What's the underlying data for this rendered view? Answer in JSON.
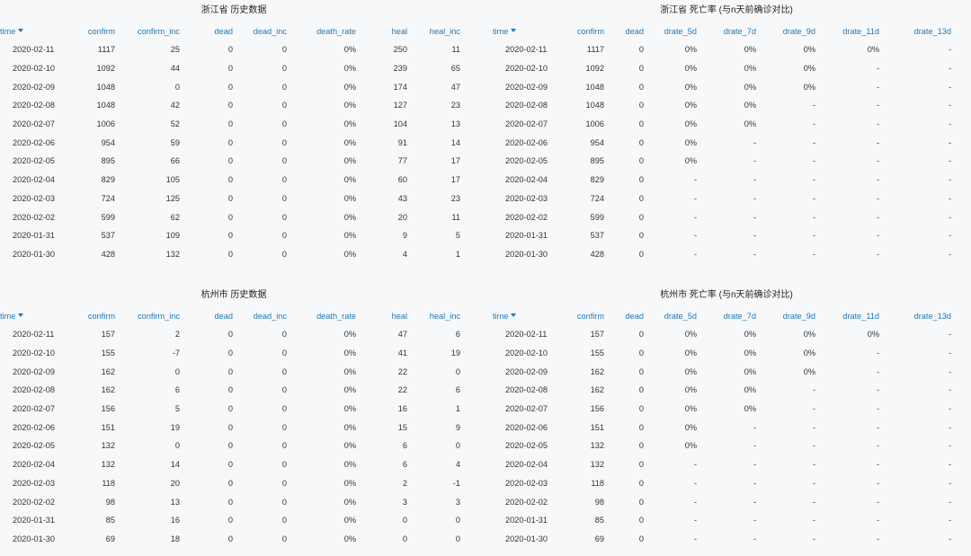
{
  "panels": [
    {
      "title": "浙江省 历史数据",
      "columns": [
        "time",
        "confirm",
        "confirm_inc",
        "dead",
        "dead_inc",
        "death_rate",
        "heal",
        "heal_inc"
      ],
      "rows": [
        [
          "2020-02-11",
          "1117",
          "25",
          "0",
          "0",
          "0%",
          "250",
          "11"
        ],
        [
          "2020-02-10",
          "1092",
          "44",
          "0",
          "0",
          "0%",
          "239",
          "65"
        ],
        [
          "2020-02-09",
          "1048",
          "0",
          "0",
          "0",
          "0%",
          "174",
          "47"
        ],
        [
          "2020-02-08",
          "1048",
          "42",
          "0",
          "0",
          "0%",
          "127",
          "23"
        ],
        [
          "2020-02-07",
          "1006",
          "52",
          "0",
          "0",
          "0%",
          "104",
          "13"
        ],
        [
          "2020-02-06",
          "954",
          "59",
          "0",
          "0",
          "0%",
          "91",
          "14"
        ],
        [
          "2020-02-05",
          "895",
          "66",
          "0",
          "0",
          "0%",
          "77",
          "17"
        ],
        [
          "2020-02-04",
          "829",
          "105",
          "0",
          "0",
          "0%",
          "60",
          "17"
        ],
        [
          "2020-02-03",
          "724",
          "125",
          "0",
          "0",
          "0%",
          "43",
          "23"
        ],
        [
          "2020-02-02",
          "599",
          "62",
          "0",
          "0",
          "0%",
          "20",
          "11"
        ],
        [
          "2020-01-31",
          "537",
          "109",
          "0",
          "0",
          "0%",
          "9",
          "5"
        ],
        [
          "2020-01-30",
          "428",
          "132",
          "0",
          "0",
          "0%",
          "4",
          "1"
        ]
      ]
    },
    {
      "title": "浙江省 死亡率 (与n天前确诊对比)",
      "columns": [
        "time",
        "confirm",
        "dead",
        "drate_5d",
        "drate_7d",
        "drate_9d",
        "drate_11d",
        "drate_13d"
      ],
      "rows": [
        [
          "2020-02-11",
          "1117",
          "0",
          "0%",
          "0%",
          "0%",
          "0%",
          "-"
        ],
        [
          "2020-02-10",
          "1092",
          "0",
          "0%",
          "0%",
          "0%",
          "-",
          "-"
        ],
        [
          "2020-02-09",
          "1048",
          "0",
          "0%",
          "0%",
          "0%",
          "-",
          "-"
        ],
        [
          "2020-02-08",
          "1048",
          "0",
          "0%",
          "0%",
          "-",
          "-",
          "-"
        ],
        [
          "2020-02-07",
          "1006",
          "0",
          "0%",
          "0%",
          "-",
          "-",
          "-"
        ],
        [
          "2020-02-06",
          "954",
          "0",
          "0%",
          "-",
          "-",
          "-",
          "-"
        ],
        [
          "2020-02-05",
          "895",
          "0",
          "0%",
          "-",
          "-",
          "-",
          "-"
        ],
        [
          "2020-02-04",
          "829",
          "0",
          "-",
          "-",
          "-",
          "-",
          "-"
        ],
        [
          "2020-02-03",
          "724",
          "0",
          "-",
          "-",
          "-",
          "-",
          "-"
        ],
        [
          "2020-02-02",
          "599",
          "0",
          "-",
          "-",
          "-",
          "-",
          "-"
        ],
        [
          "2020-01-31",
          "537",
          "0",
          "-",
          "-",
          "-",
          "-",
          "-"
        ],
        [
          "2020-01-30",
          "428",
          "0",
          "-",
          "-",
          "-",
          "-",
          "-"
        ]
      ]
    },
    {
      "title": "杭州市 历史数据",
      "columns": [
        "time",
        "confirm",
        "confirm_inc",
        "dead",
        "dead_inc",
        "death_rate",
        "heal",
        "heal_inc"
      ],
      "rows": [
        [
          "2020-02-11",
          "157",
          "2",
          "0",
          "0",
          "0%",
          "47",
          "6"
        ],
        [
          "2020-02-10",
          "155",
          "-7",
          "0",
          "0",
          "0%",
          "41",
          "19"
        ],
        [
          "2020-02-09",
          "162",
          "0",
          "0",
          "0",
          "0%",
          "22",
          "0"
        ],
        [
          "2020-02-08",
          "162",
          "6",
          "0",
          "0",
          "0%",
          "22",
          "6"
        ],
        [
          "2020-02-07",
          "156",
          "5",
          "0",
          "0",
          "0%",
          "16",
          "1"
        ],
        [
          "2020-02-06",
          "151",
          "19",
          "0",
          "0",
          "0%",
          "15",
          "9"
        ],
        [
          "2020-02-05",
          "132",
          "0",
          "0",
          "0",
          "0%",
          "6",
          "0"
        ],
        [
          "2020-02-04",
          "132",
          "14",
          "0",
          "0",
          "0%",
          "6",
          "4"
        ],
        [
          "2020-02-03",
          "118",
          "20",
          "0",
          "0",
          "0%",
          "2",
          "-1"
        ],
        [
          "2020-02-02",
          "98",
          "13",
          "0",
          "0",
          "0%",
          "3",
          "3"
        ],
        [
          "2020-01-31",
          "85",
          "16",
          "0",
          "0",
          "0%",
          "0",
          "0"
        ],
        [
          "2020-01-30",
          "69",
          "18",
          "0",
          "0",
          "0%",
          "0",
          "0"
        ]
      ]
    },
    {
      "title": "杭州市 死亡率 (与n天前确诊对比)",
      "columns": [
        "time",
        "confirm",
        "dead",
        "drate_5d",
        "drate_7d",
        "drate_9d",
        "drate_11d",
        "drate_13d"
      ],
      "rows": [
        [
          "2020-02-11",
          "157",
          "0",
          "0%",
          "0%",
          "0%",
          "0%",
          "-"
        ],
        [
          "2020-02-10",
          "155",
          "0",
          "0%",
          "0%",
          "0%",
          "-",
          "-"
        ],
        [
          "2020-02-09",
          "162",
          "0",
          "0%",
          "0%",
          "0%",
          "-",
          "-"
        ],
        [
          "2020-02-08",
          "162",
          "0",
          "0%",
          "0%",
          "-",
          "-",
          "-"
        ],
        [
          "2020-02-07",
          "156",
          "0",
          "0%",
          "0%",
          "-",
          "-",
          "-"
        ],
        [
          "2020-02-06",
          "151",
          "0",
          "0%",
          "-",
          "-",
          "-",
          "-"
        ],
        [
          "2020-02-05",
          "132",
          "0",
          "0%",
          "-",
          "-",
          "-",
          "-"
        ],
        [
          "2020-02-04",
          "132",
          "0",
          "-",
          "-",
          "-",
          "-",
          "-"
        ],
        [
          "2020-02-03",
          "118",
          "0",
          "-",
          "-",
          "-",
          "-",
          "-"
        ],
        [
          "2020-02-02",
          "98",
          "0",
          "-",
          "-",
          "-",
          "-",
          "-"
        ],
        [
          "2020-01-31",
          "85",
          "0",
          "-",
          "-",
          "-",
          "-",
          "-"
        ],
        [
          "2020-01-30",
          "69",
          "0",
          "-",
          "-",
          "-",
          "-",
          "-"
        ]
      ]
    }
  ]
}
